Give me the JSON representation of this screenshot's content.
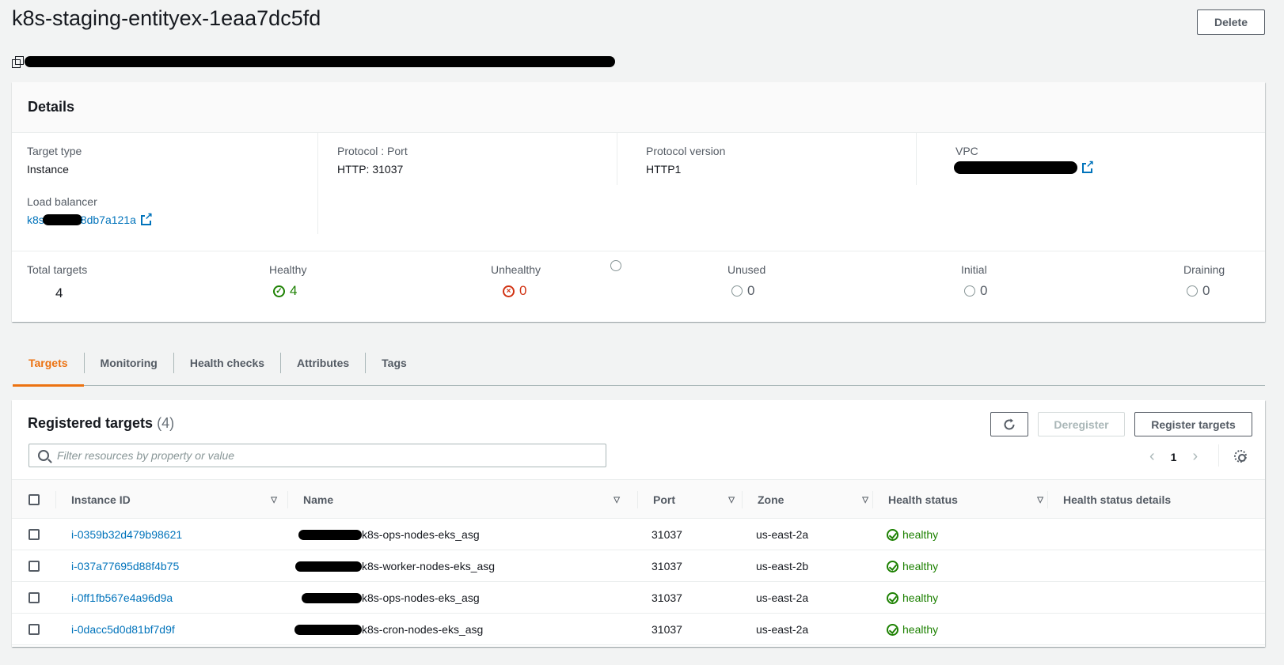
{
  "header": {
    "title": "k8s-staging-entityex-1eaa7dc5fd",
    "delete_label": "Delete"
  },
  "details": {
    "title": "Details",
    "target_type_label": "Target type",
    "target_type_value": "Instance",
    "protocol_port_label": "Protocol : Port",
    "protocol_port_value": "HTTP: 31037",
    "protocol_version_label": "Protocol version",
    "protocol_version_value": "HTTP1",
    "vpc_label": "VPC",
    "load_balancer_label": "Load balancer",
    "load_balancer_prefix": "k8s",
    "load_balancer_suffix": "8db7a121a"
  },
  "counts": {
    "total_label": "Total targets",
    "total_value": "4",
    "healthy_label": "Healthy",
    "healthy_value": "4",
    "unhealthy_label": "Unhealthy",
    "unhealthy_value": "0",
    "unused_label": "Unused",
    "unused_value": "0",
    "initial_label": "Initial",
    "initial_value": "0",
    "draining_label": "Draining",
    "draining_value": "0"
  },
  "tabs": [
    {
      "label": "Targets"
    },
    {
      "label": "Monitoring"
    },
    {
      "label": "Health checks"
    },
    {
      "label": "Attributes"
    },
    {
      "label": "Tags"
    }
  ],
  "registered": {
    "title": "Registered targets",
    "count": "(4)",
    "deregister_label": "Deregister",
    "register_label": "Register targets",
    "filter_placeholder": "Filter resources by property or value",
    "page": "1"
  },
  "table": {
    "columns": {
      "instance_id": "Instance ID",
      "name": "Name",
      "port": "Port",
      "zone": "Zone",
      "health_status": "Health status",
      "health_details": "Health status details"
    },
    "rows": [
      {
        "instance_id": "i-0359b32d479b98621",
        "name": "k8s-ops-nodes-eks_asg",
        "port": "31037",
        "zone": "us-east-2a",
        "health": "healthy"
      },
      {
        "instance_id": "i-037a77695d88f4b75",
        "name": "k8s-worker-nodes-eks_asg",
        "port": "31037",
        "zone": "us-east-2b",
        "health": "healthy"
      },
      {
        "instance_id": "i-0ff1fb567e4a96d9a",
        "name": "k8s-ops-nodes-eks_asg",
        "port": "31037",
        "zone": "us-east-2a",
        "health": "healthy"
      },
      {
        "instance_id": "i-0dacc5d0d81bf7d9f",
        "name": "k8s-cron-nodes-eks_asg",
        "port": "31037",
        "zone": "us-east-2a",
        "health": "healthy"
      }
    ]
  },
  "colors": {
    "accent": "#ec7211",
    "link": "#0073bb",
    "healthy": "#1d8102",
    "unhealthy": "#d13212"
  }
}
